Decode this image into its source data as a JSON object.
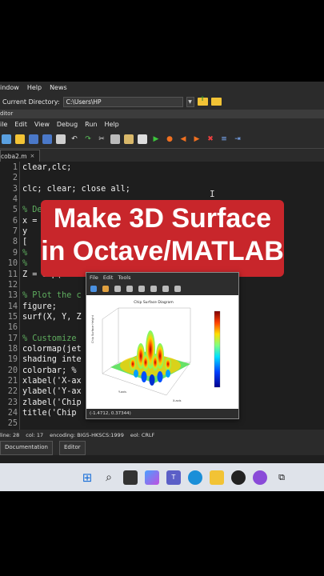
{
  "menubar": {
    "items": [
      "indow",
      "Help",
      "News"
    ]
  },
  "dirbar": {
    "label": "Current Directory:",
    "path": "C:\\Users\\HP"
  },
  "editor_label": "ditor",
  "editor_menu": [
    "ile",
    "Edit",
    "View",
    "Debug",
    "Run",
    "Help"
  ],
  "tab": {
    "name": "coba2.m",
    "close": "×"
  },
  "code_lines": [
    {
      "n": "1",
      "t": "clear,clc;"
    },
    {
      "n": "2",
      "t": ""
    },
    {
      "n": "3",
      "t": "clc; clear; close all;"
    },
    {
      "n": "4",
      "t": ""
    },
    {
      "n": "5",
      "t": "% De",
      "c": true
    },
    {
      "n": "6",
      "t": "x = "
    },
    {
      "n": "7",
      "t": "y"
    },
    {
      "n": "8",
      "t": "["
    },
    {
      "n": "9",
      "t": "%",
      "c": true
    },
    {
      "n": "10",
      "t": "%                                        ape)",
      "c": true
    },
    {
      "n": "11",
      "t": "Z = exp(-0.1                   * sin(2*Y);"
    },
    {
      "n": "12",
      "t": ""
    },
    {
      "n": "13",
      "t": "% Plot the c",
      "c": true
    },
    {
      "n": "14",
      "t": "figure;"
    },
    {
      "n": "15",
      "t": "surf(X, Y, Z"
    },
    {
      "n": "16",
      "t": ""
    },
    {
      "n": "17",
      "t": "% Customize",
      "c": true
    },
    {
      "n": "18",
      "t": "colormap(jet"
    },
    {
      "n": "19",
      "t": "shading inte"
    },
    {
      "n": "20",
      "t": "colorbar; %"
    },
    {
      "n": "21",
      "t": "xlabel('X-ax"
    },
    {
      "n": "22",
      "t": "ylabel('Y-ax"
    },
    {
      "n": "23",
      "t": "zlabel('Chip"
    },
    {
      "n": "24",
      "t": "title('Chip "
    },
    {
      "n": "25",
      "t": ""
    }
  ],
  "status": {
    "line": "line: 28",
    "col": "col: 17",
    "encoding": "encoding: BIG5-HKSCS:1999",
    "eol": "eol: CRLF"
  },
  "bottom_tabs": [
    "Documentation",
    "Editor"
  ],
  "banner": {
    "line1": "Make 3D Surface",
    "line2": "in Octave/MATLAB"
  },
  "plot_window": {
    "menu": [
      "File",
      "Edit",
      "Tools"
    ],
    "title": "Chip Surface Diagram",
    "zlabel": "Chip Surface Height",
    "xlabel": "X-axis",
    "ylabel": "Y-axis",
    "status": "(-1.4712, 0.37344)"
  },
  "colors": {
    "banner": "#c8262b",
    "comment": "#5fae5f",
    "background": "#1e1e1e"
  }
}
